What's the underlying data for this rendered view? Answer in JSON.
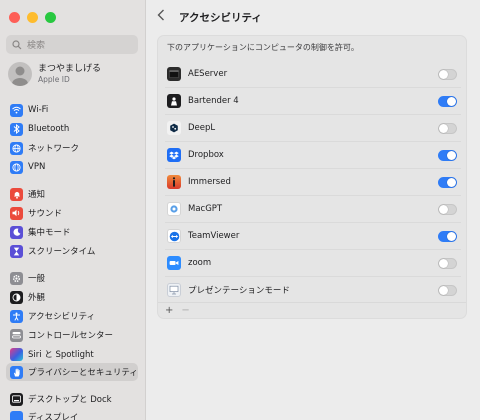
{
  "search": {
    "placeholder": "検索"
  },
  "account": {
    "name": "まつやましげる",
    "sub": "Apple ID"
  },
  "sidebar": {
    "items": [
      {
        "label": "Wi-Fi",
        "icon": "wifi-icon",
        "color": "#2f7cf6"
      },
      {
        "label": "Bluetooth",
        "icon": "bluetooth-icon",
        "color": "#2f7cf6"
      },
      {
        "label": "ネットワーク",
        "icon": "globe-icon",
        "color": "#2f7cf6"
      },
      {
        "label": "VPN",
        "icon": "vpn-icon",
        "color": "#2f7cf6"
      },
      {
        "label": "通知",
        "icon": "bell-icon",
        "color": "#eb4a3c"
      },
      {
        "label": "サウンド",
        "icon": "speaker-icon",
        "color": "#eb4a3c"
      },
      {
        "label": "集中モード",
        "icon": "moon-icon",
        "color": "#5b4fd6"
      },
      {
        "label": "スクリーンタイム",
        "icon": "hourglass-icon",
        "color": "#5b4fd6"
      },
      {
        "label": "一般",
        "icon": "gear-icon",
        "color": "#8e8e93"
      },
      {
        "label": "外観",
        "icon": "appearance-icon",
        "color": "#1d1d1f"
      },
      {
        "label": "アクセシビリティ",
        "icon": "accessibility-icon",
        "color": "#2f7cf6"
      },
      {
        "label": "コントロールセンター",
        "icon": "control-center-icon",
        "color": "#8e8e93"
      },
      {
        "label": "Siri と Spotlight",
        "icon": "siri-icon",
        "color": "#3b3b8f"
      },
      {
        "label": "プライバシーとセキュリティ",
        "icon": "hand-icon",
        "color": "#2f7cf6"
      },
      {
        "label": "デスクトップと Dock",
        "icon": "dock-icon",
        "color": "#1d1d1f"
      },
      {
        "label": "ディスプレイ",
        "icon": "display-icon",
        "color": "#2f7cf6"
      }
    ]
  },
  "main": {
    "title": "アクセシビリティ",
    "description": "下のアプリケーションにコンピュータの制御を許可。",
    "apps": [
      {
        "name": "AEServer",
        "enabled": false,
        "icon": "terminal-icon",
        "color": "#2b2b2b"
      },
      {
        "name": "Bartender 4",
        "enabled": true,
        "icon": "bartender-icon",
        "color": "#1d1d1f"
      },
      {
        "name": "DeepL",
        "enabled": false,
        "icon": "deepl-icon",
        "color": "#0f2b46"
      },
      {
        "name": "Dropbox",
        "enabled": true,
        "icon": "dropbox-icon",
        "color": "#1f6ef5"
      },
      {
        "name": "Immersed",
        "enabled": true,
        "icon": "immersed-icon",
        "color": "#e4572e"
      },
      {
        "name": "MacGPT",
        "enabled": false,
        "icon": "macgpt-icon",
        "color": "#5aa0e8"
      },
      {
        "name": "TeamViewer",
        "enabled": true,
        "icon": "teamviewer-icon",
        "color": "#1a73e8"
      },
      {
        "name": "zoom",
        "enabled": false,
        "icon": "zoom-icon",
        "color": "#2d8cff"
      },
      {
        "name": "プレゼンテーションモード",
        "enabled": false,
        "icon": "presentation-icon",
        "color": "#7f8da3"
      }
    ],
    "footer": {
      "add": "+",
      "remove": "−"
    }
  }
}
